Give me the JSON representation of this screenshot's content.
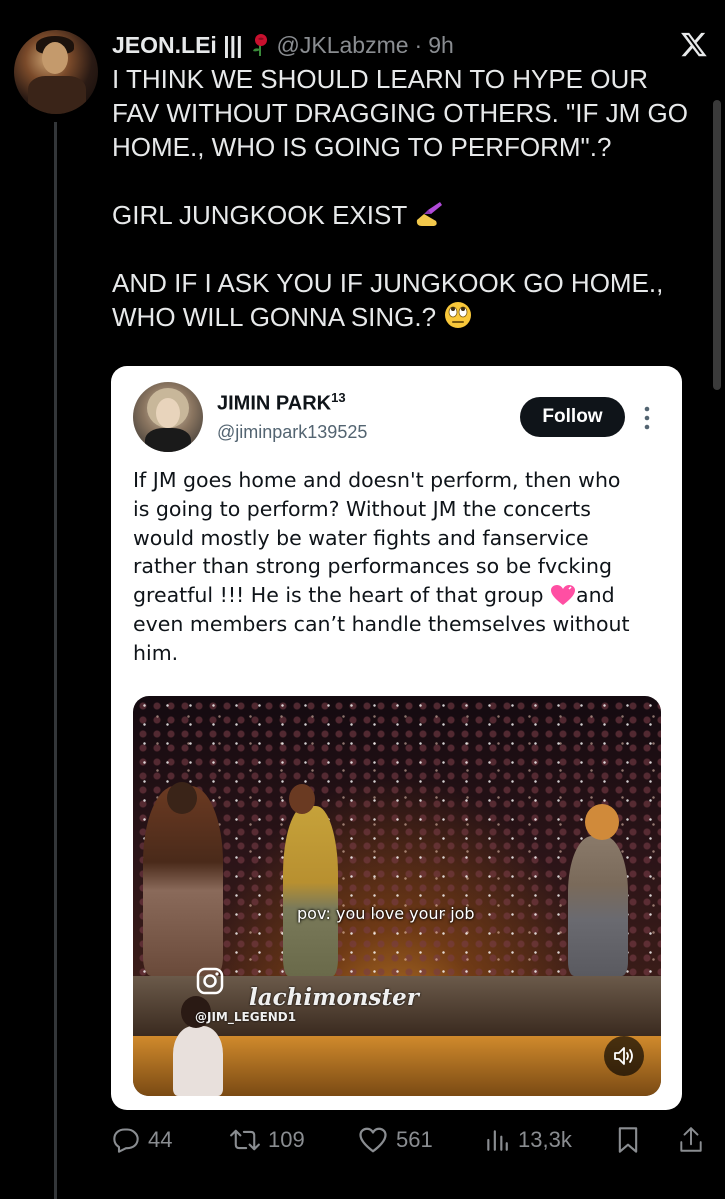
{
  "tweet": {
    "author_name": "JEON.LEi |||",
    "handle": "@JKLabzme",
    "separator": "·",
    "time": "9h",
    "text_lines": [
      "I THINK WE SHOULD LEARN TO HYPE OUR",
      "FAV WITHOUT DRAGGING OTHERS. \"IF JM GO",
      "HOME., WHO IS GOING TO PERFORM\".?",
      "",
      "GIRL JUNGKOOK EXIST",
      "",
      "AND IF I ASK YOU IF JUNGKOOK GO HOME.,",
      "WHO WILL GONNA SING.?"
    ],
    "emojis": [
      "nail-polish-emoji",
      "eye-roll-emoji"
    ]
  },
  "quoted": {
    "author_name": "JIMIN PARK",
    "author_superscript": "13",
    "handle": "@jiminpark139525",
    "follow_label": "Follow",
    "text_lines": [
      "If JM goes home and doesn't perform, then who",
      "is going to perform? Without JM the concerts",
      "would mostly be water fights and fanservice",
      "rather than strong performances so be fvcking",
      "greatful !!! He is the heart of that group",
      "even members can’t handle themselves without",
      "him."
    ],
    "line5_suffix": "and",
    "video": {
      "caption": "pov: you love your job",
      "watermark": "lachimonster",
      "watermark_handle": "@JIM_LEGEND1"
    }
  },
  "actions": {
    "replies": "44",
    "reposts": "109",
    "likes": "561",
    "views": "13,3k"
  },
  "colors": {
    "background": "#000000",
    "text": "#e7e9ea",
    "muted": "#8a8d91",
    "card_bg": "#ffffff",
    "follow_bg": "#0f1419",
    "heart_emoji": "#ff4fa3"
  }
}
